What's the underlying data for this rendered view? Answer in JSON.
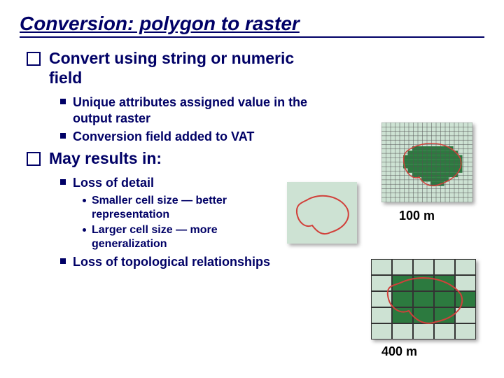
{
  "title": "Conversion: polygon to raster",
  "bullets": {
    "b1": "Convert using string or numeric field",
    "b1s1": "Unique attributes assigned value in the output raster",
    "b1s2": "Conversion field added to VAT",
    "b2": "May results in:",
    "b2s1": "Loss of detail",
    "b2s1a": "Smaller cell size — better representation",
    "b2s1b": "Larger cell size — more generalization",
    "b2s2": "Loss of topological relationships"
  },
  "labels": {
    "fine": "100 m",
    "coarse": "400 m"
  },
  "figures": {
    "fine_cells_note": "fine raster with green cells approximating a polygon and red outline of original polygon",
    "mid_note": "polygon outline only (vector)",
    "coarse_note": "coarse raster approximation with few large cells and red outline"
  }
}
